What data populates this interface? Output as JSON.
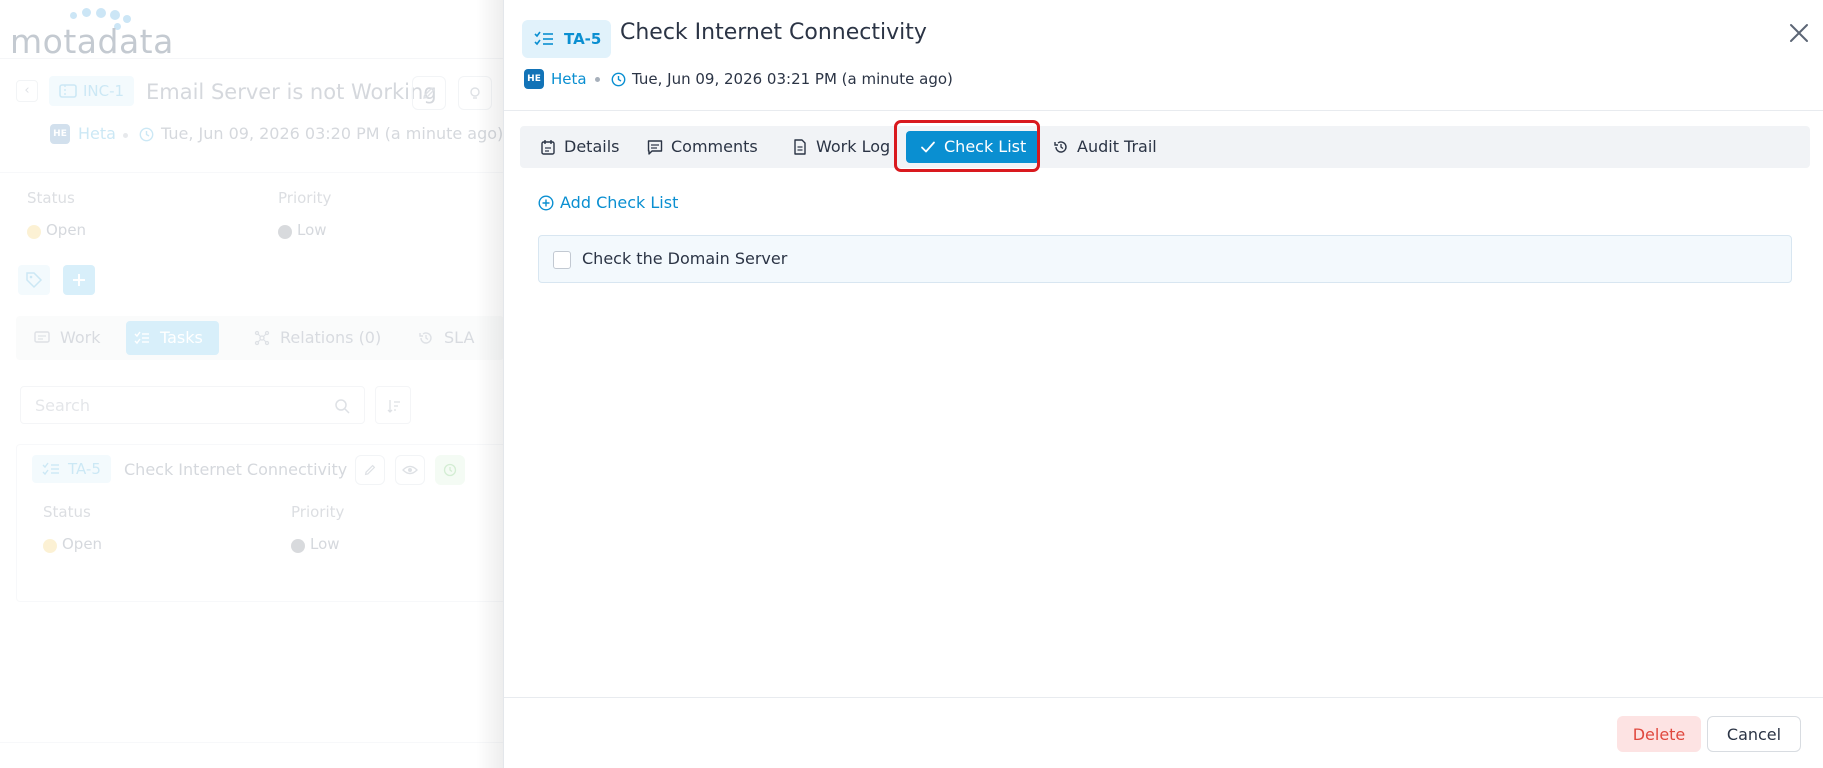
{
  "background": {
    "logo_text": "motadata",
    "ticket": {
      "id": "INC-1",
      "title": "Email Server is not Working",
      "owner_initials": "HE",
      "owner": "Heta",
      "created": "Tue, Jun 09, 2026 03:20 PM (a minute ago)"
    },
    "fields": {
      "status_label": "Status",
      "status_value": "Open",
      "priority_label": "Priority",
      "priority_value": "Low"
    },
    "tabs": [
      {
        "label": "Work"
      },
      {
        "label": "Tasks"
      },
      {
        "label": "Relations (0)"
      },
      {
        "label": "SLA"
      }
    ],
    "search_placeholder": "Search",
    "task_card": {
      "id": "TA-5",
      "title": "Check Internet Connectivity",
      "status_label": "Status",
      "status_value": "Open",
      "priority_label": "Priority",
      "priority_value": "Low"
    }
  },
  "drawer": {
    "task_id": "TA-5",
    "title": "Check Internet Connectivity",
    "owner_initials": "HE",
    "owner": "Heta",
    "created": "Tue, Jun 09, 2026 03:21 PM (a minute ago)",
    "tabs": [
      {
        "label": "Details"
      },
      {
        "label": "Comments"
      },
      {
        "label": "Work Log"
      },
      {
        "label": "Check List"
      },
      {
        "label": "Audit Trail"
      }
    ],
    "add_checklist_label": "Add Check List",
    "checklist_items": [
      {
        "text": "Check the Domain Server",
        "checked": false
      }
    ],
    "footer": {
      "delete_label": "Delete",
      "cancel_label": "Cancel"
    }
  },
  "colors": {
    "primary": "#0a8fd1",
    "status_open": "#f8d56a",
    "priority_low": "#8a8f96",
    "danger": "#e0483e",
    "highlight": "#d9191e"
  }
}
